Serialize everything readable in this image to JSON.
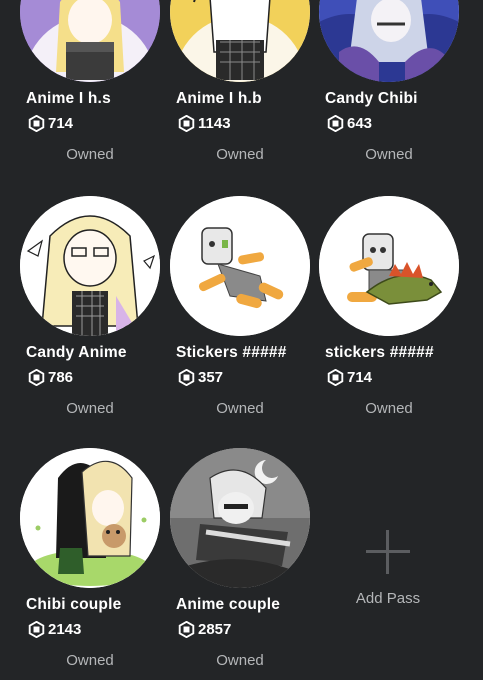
{
  "currency_icon": "robux-icon",
  "colors": {
    "background": "#232527",
    "text": "#ffffff",
    "muted": "#b4b6b8"
  },
  "passes": [
    {
      "name": "Anime I h.s",
      "price": "714",
      "status": "Owned"
    },
    {
      "name": "Anime I h.b",
      "price": "1143",
      "status": "Owned"
    },
    {
      "name": "Candy Chibi",
      "price": "643",
      "status": "Owned"
    },
    {
      "name": "Candy Anime",
      "price": "786",
      "status": "Owned"
    },
    {
      "name": "Stickers #####",
      "price": "357",
      "status": "Owned"
    },
    {
      "name": "stickers #####",
      "price": "714",
      "status": "Owned"
    },
    {
      "name": "Chibi couple",
      "price": "2143",
      "status": "Owned"
    },
    {
      "name": "Anime couple",
      "price": "2857",
      "status": "Owned"
    }
  ],
  "add_pass": {
    "label": "Add Pass",
    "icon": "plus-icon"
  }
}
